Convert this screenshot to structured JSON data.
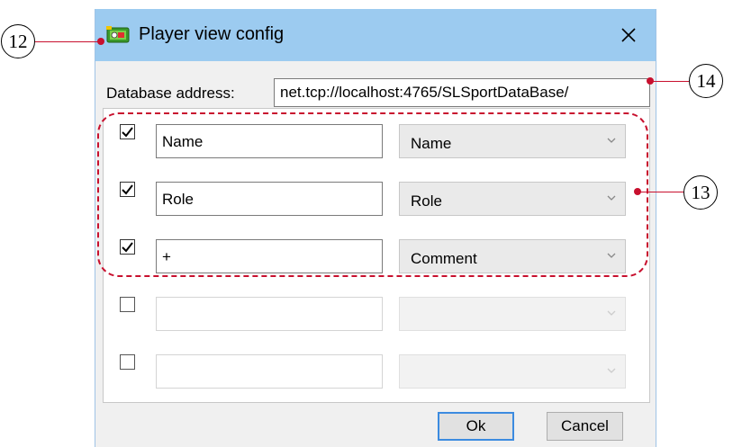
{
  "window": {
    "title": "Player view config",
    "close_symbol": "✕"
  },
  "database": {
    "label": "Database address:",
    "value": "net.tcp://localhost:4765/SLSportDataBase/"
  },
  "rows": [
    {
      "checked": true,
      "text": "Name",
      "select": "Name",
      "enabled": true
    },
    {
      "checked": true,
      "text": "Role",
      "select": "Role",
      "enabled": true
    },
    {
      "checked": true,
      "text": "+",
      "select": "Comment",
      "enabled": true
    },
    {
      "checked": false,
      "text": "",
      "select": "",
      "enabled": false
    },
    {
      "checked": false,
      "text": "",
      "select": "",
      "enabled": false
    }
  ],
  "buttons": {
    "ok_label": "Ok",
    "cancel_label": "Cancel"
  },
  "callouts": {
    "title_callout": "12",
    "group_callout": "13",
    "database_callout": "14"
  },
  "colors": {
    "titlebar": "#9ccbf0",
    "annotation_red": "#c8102e",
    "ok_border": "#3c8be0"
  },
  "icons": {
    "app": "player-view-app-icon",
    "close": "close-icon",
    "check": "checkmark-icon",
    "dropdown": "chevron-down-icon"
  }
}
